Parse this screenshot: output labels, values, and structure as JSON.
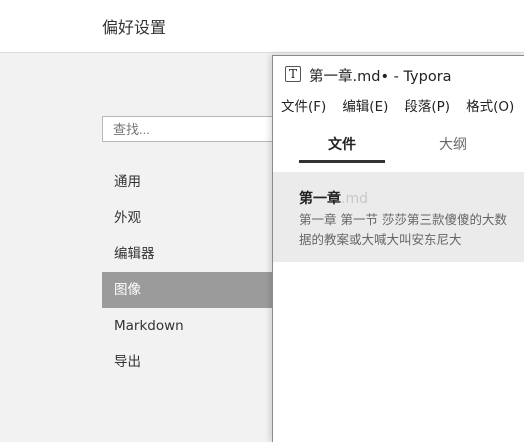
{
  "preferences": {
    "title": "偏好设置",
    "search": {
      "placeholder": "查找..."
    },
    "nav": [
      {
        "label": "通用"
      },
      {
        "label": "外观"
      },
      {
        "label": "编辑器"
      },
      {
        "label": "图像",
        "active": true
      },
      {
        "label": "Markdown"
      },
      {
        "label": "导出"
      }
    ]
  },
  "typora": {
    "icon_letter": "T",
    "window_title": "第一章.md• - Typora",
    "menu": [
      "文件(F)",
      "编辑(E)",
      "段落(P)",
      "格式(O)"
    ],
    "sidebar_tabs": {
      "files": "文件",
      "outline": "大纲"
    },
    "file": {
      "name": "第一章",
      "ext": ".md",
      "preview": "第一章 第一节 莎莎第三款傻傻的大数据的教案或大喊大叫安东尼大"
    }
  },
  "colors": {
    "active_nav_bg": "#9b9b9b",
    "selected_file_bg": "#ebebeb"
  }
}
